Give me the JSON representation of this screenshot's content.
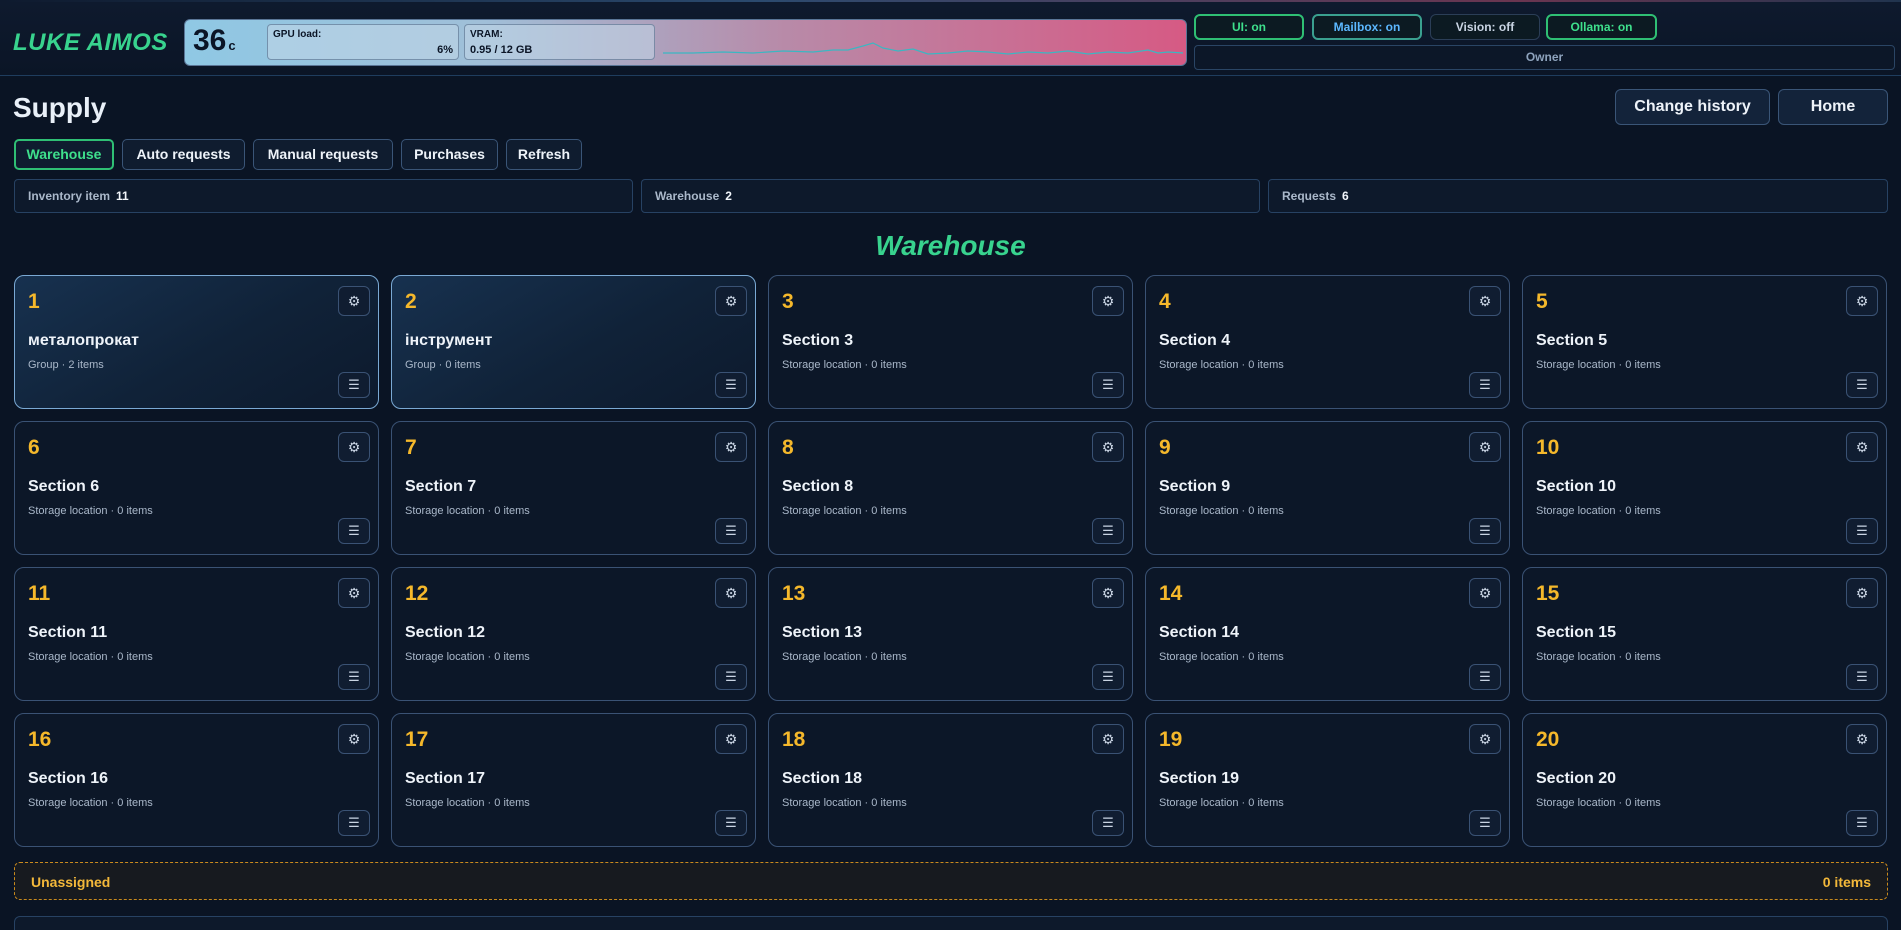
{
  "brand": "LUKE AIMOS",
  "gpu": {
    "temperature": "36",
    "temperature_unit": "c",
    "load_label": "GPU load:",
    "load_value": "6%",
    "vram_label": "VRAM:",
    "vram_value": "0.95 / 12 GB"
  },
  "services": [
    {
      "label": "UI: on",
      "state": "on"
    },
    {
      "label": "Mailbox: on",
      "state": "on"
    },
    {
      "label": "Vision: off",
      "state": "off"
    },
    {
      "label": "Ollama: on",
      "state": "on"
    }
  ],
  "user_role": "Owner",
  "page": {
    "title": "Supply",
    "change_history_label": "Change history",
    "home_label": "Home"
  },
  "tabs": [
    {
      "label": "Warehouse",
      "active": true
    },
    {
      "label": "Auto requests",
      "active": false
    },
    {
      "label": "Manual requests",
      "active": false
    },
    {
      "label": "Purchases",
      "active": false
    },
    {
      "label": "Refresh",
      "active": false
    }
  ],
  "stats": [
    {
      "label": "Inventory item",
      "value": "11"
    },
    {
      "label": "Warehouse",
      "value": "2"
    },
    {
      "label": "Requests",
      "value": "6"
    }
  ],
  "section_title": "Warehouse",
  "sections": [
    {
      "number": "1",
      "name": "металопрокат",
      "meta": "Group · 2 items"
    },
    {
      "number": "2",
      "name": "інструмент",
      "meta": "Group · 0 items"
    },
    {
      "number": "3",
      "name": "Section 3",
      "meta": "Storage location · 0 items"
    },
    {
      "number": "4",
      "name": "Section 4",
      "meta": "Storage location · 0 items"
    },
    {
      "number": "5",
      "name": "Section 5",
      "meta": "Storage location · 0 items"
    },
    {
      "number": "6",
      "name": "Section 6",
      "meta": "Storage location · 0 items"
    },
    {
      "number": "7",
      "name": "Section 7",
      "meta": "Storage location · 0 items"
    },
    {
      "number": "8",
      "name": "Section 8",
      "meta": "Storage location · 0 items"
    },
    {
      "number": "9",
      "name": "Section 9",
      "meta": "Storage location · 0 items"
    },
    {
      "number": "10",
      "name": "Section 10",
      "meta": "Storage location · 0 items"
    },
    {
      "number": "11",
      "name": "Section 11",
      "meta": "Storage location · 0 items"
    },
    {
      "number": "12",
      "name": "Section 12",
      "meta": "Storage location · 0 items"
    },
    {
      "number": "13",
      "name": "Section 13",
      "meta": "Storage location · 0 items"
    },
    {
      "number": "14",
      "name": "Section 14",
      "meta": "Storage location · 0 items"
    },
    {
      "number": "15",
      "name": "Section 15",
      "meta": "Storage location · 0 items"
    },
    {
      "number": "16",
      "name": "Section 16",
      "meta": "Storage location · 0 items"
    },
    {
      "number": "17",
      "name": "Section 17",
      "meta": "Storage location · 0 items"
    },
    {
      "number": "18",
      "name": "Section 18",
      "meta": "Storage location · 0 items"
    },
    {
      "number": "19",
      "name": "Section 19",
      "meta": "Storage location · 0 items"
    },
    {
      "number": "20",
      "name": "Section 20",
      "meta": "Storage location · 0 items"
    }
  ],
  "unassigned": {
    "label": "Unassigned",
    "count": "0 items"
  },
  "icons": {
    "settings": "gear-icon",
    "menu": "menu-icon"
  },
  "colors": {
    "accent_green": "#38d38e",
    "number_gold": "#f5b82b",
    "background": "#0a1424"
  }
}
